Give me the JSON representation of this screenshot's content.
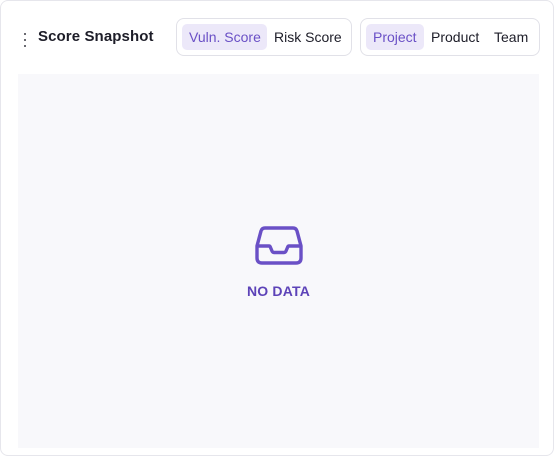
{
  "widget": {
    "title": "Score Snapshot",
    "menu_icon": "kebab-vertical-icon"
  },
  "score_type_toggle": {
    "options": [
      "Vuln. Score",
      "Risk Score"
    ],
    "selected": "Vuln. Score"
  },
  "group_by_toggle": {
    "options": [
      "Project",
      "Product",
      "Team"
    ],
    "selected": "Project"
  },
  "empty_state": {
    "icon": "inbox-tray-icon",
    "message": "NO DATA"
  },
  "colors": {
    "accent": "#6a50c6",
    "accent_bg": "#ece8f9",
    "empty_text": "#5d43b8",
    "panel_bg": "#f8f8fb",
    "border": "#e1e1e8"
  }
}
